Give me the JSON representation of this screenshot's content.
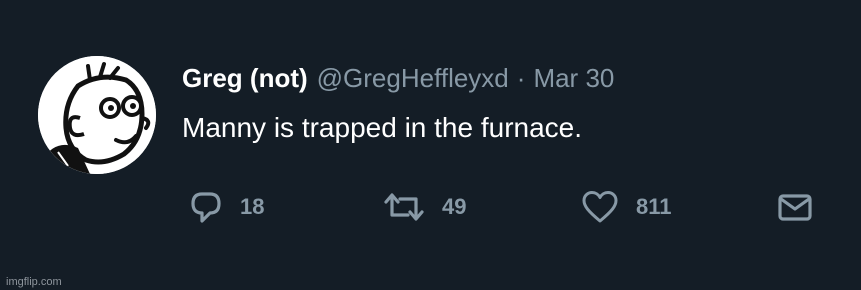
{
  "tweet": {
    "display_name": "Greg (not)",
    "handle": "@GregHeffleyxd",
    "separator": "·",
    "date": "Mar 30",
    "text": "Manny is trapped in the furnace.",
    "avatar_icon": "greg-heffley-cartoon-face"
  },
  "actions": {
    "reply": {
      "icon": "reply-bubble-icon",
      "count": "18"
    },
    "retweet": {
      "icon": "retweet-arrows-icon",
      "count": "49"
    },
    "like": {
      "icon": "heart-icon",
      "count": "811"
    },
    "dm": {
      "icon": "envelope-icon"
    }
  },
  "watermark": "imgflip.com",
  "colors": {
    "background": "#141d26",
    "primary_text": "#ffffff",
    "secondary_text": "#8899a6"
  }
}
